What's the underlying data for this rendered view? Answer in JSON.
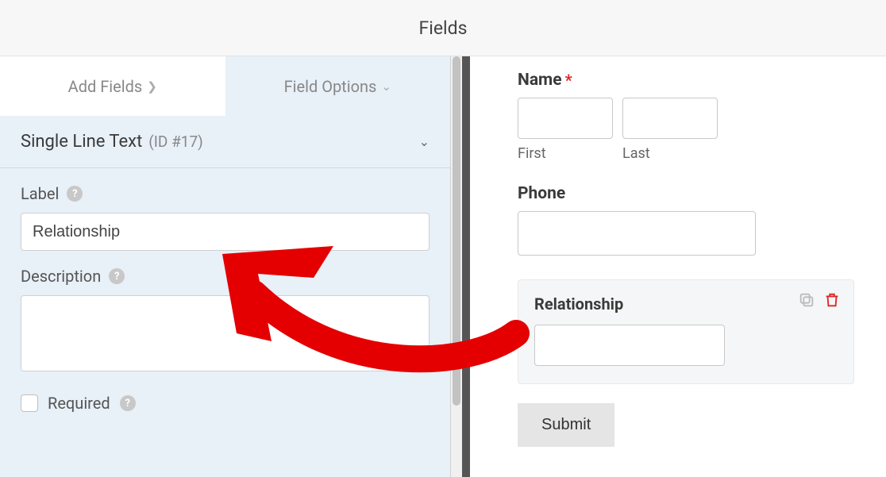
{
  "header": {
    "title": "Fields"
  },
  "tabs": {
    "add_fields": "Add Fields",
    "field_options": "Field Options"
  },
  "section": {
    "title": "Single Line Text",
    "id_label": "(ID #17)"
  },
  "form_editor": {
    "label_label": "Label",
    "label_value": "Relationship",
    "description_label": "Description",
    "description_value": "",
    "required_label": "Required"
  },
  "preview": {
    "name_label": "Name",
    "first_sublabel": "First",
    "last_sublabel": "Last",
    "phone_label": "Phone",
    "relationship_label": "Relationship",
    "submit_label": "Submit"
  },
  "colors": {
    "accent_red": "#e40000",
    "panel_bg": "#e8f0f8"
  }
}
